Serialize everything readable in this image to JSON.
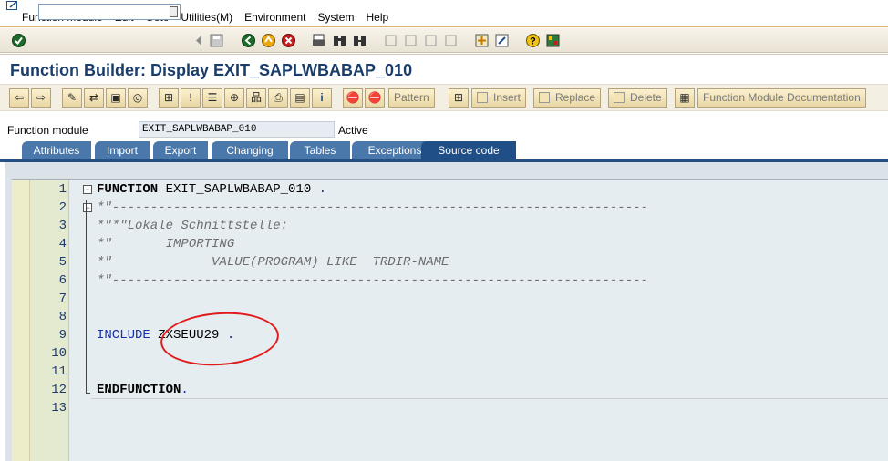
{
  "menu": [
    "Function Module",
    "Edit",
    "Goto",
    "Utilities(M)",
    "Environment",
    "System",
    "Help"
  ],
  "command_field": {
    "value": ""
  },
  "title": "Function Builder: Display EXIT_SAPLWBABAP_010",
  "app_toolbar": {
    "pattern": "Pattern",
    "insert": "Insert",
    "replace": "Replace",
    "delete": "Delete",
    "fm_docs": "Function Module Documentation"
  },
  "function_module": {
    "label": "Function module",
    "value": "EXIT_SAPLWBABAP_010",
    "status": "Active"
  },
  "tabs": [
    "Attributes",
    "Import",
    "Export",
    "Changing",
    "Tables",
    "Exceptions",
    "Source code"
  ],
  "active_tab": "Source code",
  "source": {
    "line_numbers": [
      "1",
      "2",
      "3",
      "4",
      "5",
      "6",
      "7",
      "8",
      "9",
      "10",
      "11",
      "12",
      "13"
    ],
    "l1_kw": "FUNCTION",
    "l1_name": " EXIT_SAPLWBABAP_010",
    "l1_dot": " .",
    "l2": "*\"----------------------------------------------------------------------",
    "l3": "*\"*\"Lokale Schnittstelle:",
    "l4": "*\"       IMPORTING",
    "l5": "*\"             VALUE(PROGRAM) LIKE  TRDIR-NAME",
    "l6": "*\"----------------------------------------------------------------------",
    "l9_kw": "INCLUDE",
    "l9_name": " ZXSEUU29",
    "l9_dot": " .",
    "l12_kw": "ENDFUNCTION",
    "l12_dot": "."
  },
  "colors": {
    "title": "#1b3d6c",
    "tab": "#4b78ab",
    "tab_active": "#1f4f86",
    "annotation": "#e11b1b"
  }
}
